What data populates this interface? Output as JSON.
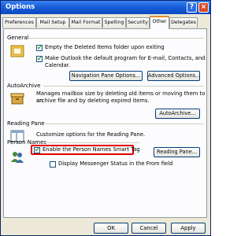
{
  "window": {
    "title": "Options",
    "help_label": "?",
    "close_label": "×"
  },
  "tabs": [
    {
      "label": "Preferences"
    },
    {
      "label": "Mail Setup"
    },
    {
      "label": "Mail Format"
    },
    {
      "label": "Spelling"
    },
    {
      "label": "Security"
    },
    {
      "label": "Other",
      "active": true
    },
    {
      "label": "Delegates"
    }
  ],
  "general": {
    "heading": "General",
    "empty_deleted_label": "Empty the Deleted Items folder upon exiting",
    "default_program_line1": "Make Outlook the default program for E-mail, Contacts, and",
    "default_program_line2": "Calendar.",
    "nav_pane_button": "Navigation Pane Options...",
    "advanced_button": "Advanced Options..."
  },
  "autoarchive": {
    "heading": "AutoArchive",
    "desc_line1": "Manages mailbox size by deleting old items or moving them to an",
    "desc_line2": "archive file and by deleting expired items.",
    "button": "AutoArchive..."
  },
  "reading_pane": {
    "heading": "Reading Pane",
    "desc": "Customize options for the Reading Pane.",
    "button": "Reading Pane..."
  },
  "person_names": {
    "heading": "Person Names",
    "smart_tag_label": "Enable the Person Names Smart Tag",
    "messenger_label": "Display Messenger Status in the From field"
  },
  "footer": {
    "ok": "OK",
    "cancel": "Cancel",
    "apply": "Apply"
  },
  "checkbox_mark": "✔",
  "colors": {
    "highlight": "#e00000",
    "titlebar": "#0b49c2"
  }
}
